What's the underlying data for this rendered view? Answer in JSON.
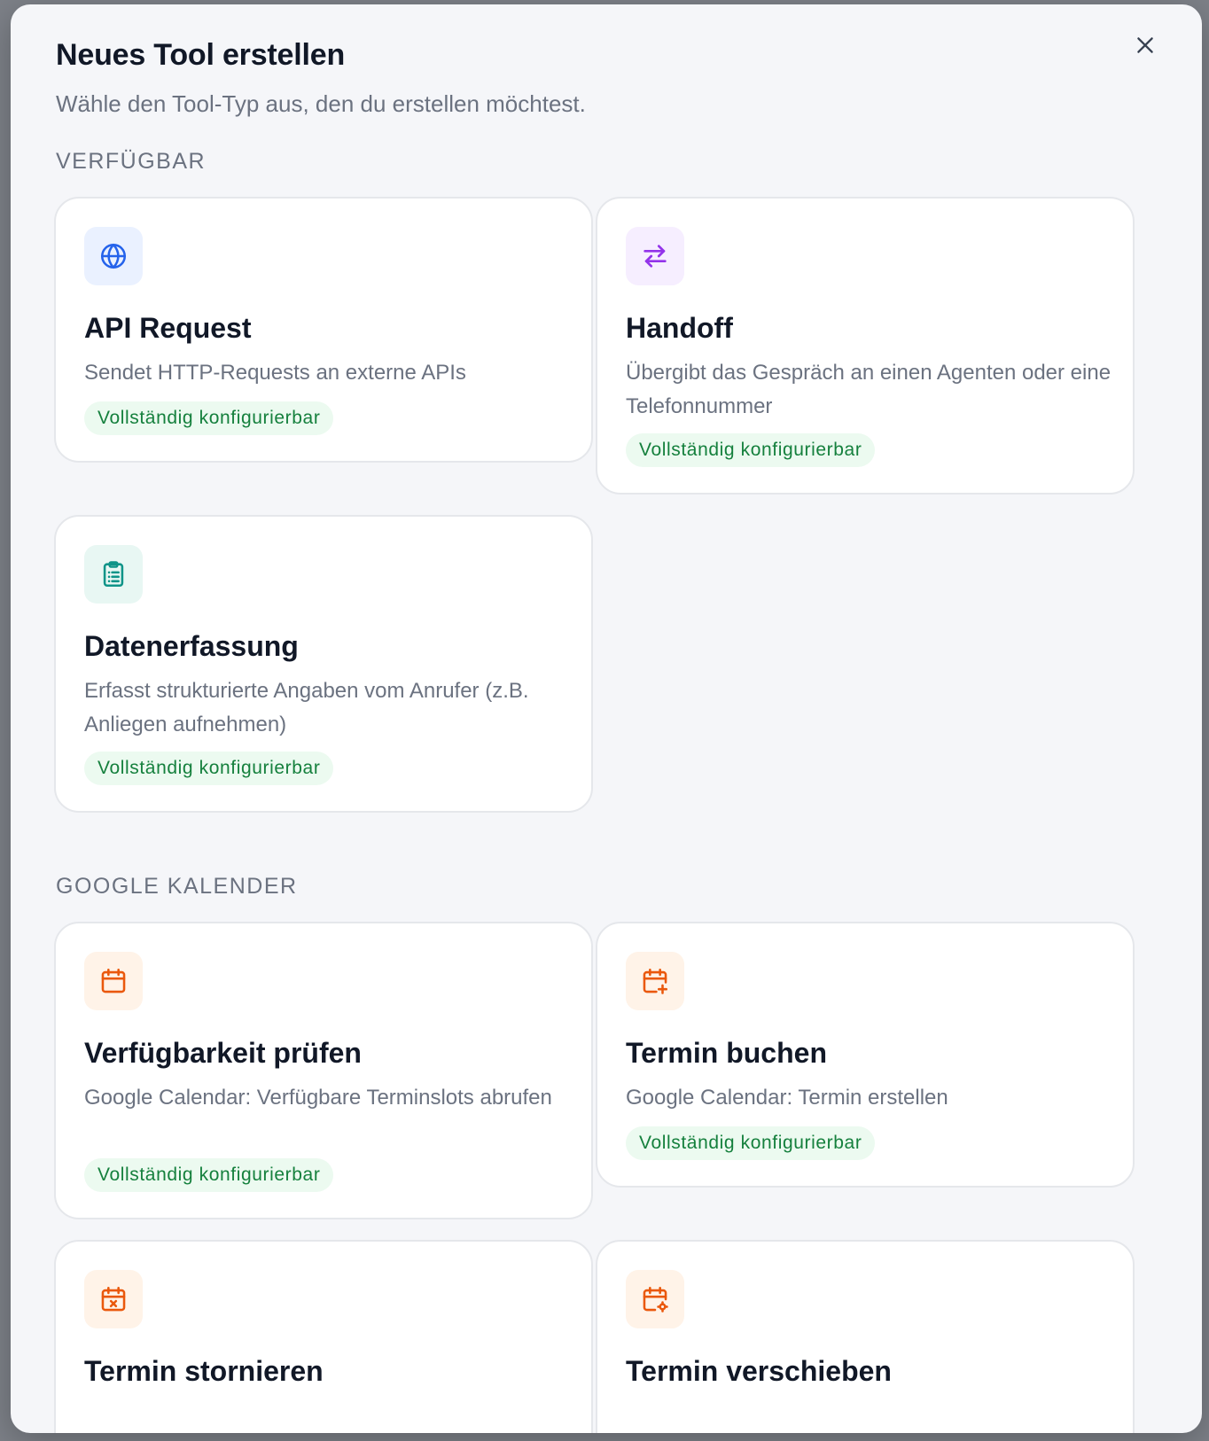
{
  "modal": {
    "title": "Neues Tool erstellen",
    "subtitle": "Wähle den Tool-Typ aus, den du erstellen möchtest.",
    "close_icon": "close-icon"
  },
  "sections": [
    {
      "label": "VERFÜGBAR",
      "cards": [
        {
          "icon": "globe-icon",
          "accent": "#2563eb",
          "title": "API Request",
          "description": "Sendet HTTP-Requests an externe APIs",
          "badge": "Vollständig konfigurierbar"
        },
        {
          "icon": "arrows-swap-icon",
          "accent": "#9333ea",
          "title": "Handoff",
          "description": "Übergibt das Gespräch an einen Agenten oder eine Telefonnummer",
          "badge": "Vollständig konfigurierbar"
        },
        {
          "icon": "clipboard-list-icon",
          "accent": "#0f9488",
          "title": "Datenerfassung",
          "description": "Erfasst strukturierte Angaben vom Anrufer (z.B. Anliegen aufnehmen)",
          "badge": "Vollständig konfigurierbar"
        }
      ]
    },
    {
      "label": "GOOGLE KALENDER",
      "cards": [
        {
          "icon": "calendar-icon",
          "accent": "#ea580c",
          "title": "Verfügbarkeit prüfen",
          "description": "Google Calendar: Verfügbare Terminslots abrufen",
          "badge": "Vollständig konfigurierbar"
        },
        {
          "icon": "calendar-plus-icon",
          "accent": "#ea580c",
          "title": "Termin buchen",
          "description": "Google Calendar: Termin erstellen",
          "badge": "Vollständig konfigurierbar"
        },
        {
          "icon": "calendar-x-icon",
          "accent": "#ea580c",
          "title": "Termin stornieren"
        },
        {
          "icon": "calendar-gear-icon",
          "accent": "#ea580c",
          "title": "Termin verschieben"
        }
      ]
    }
  ]
}
